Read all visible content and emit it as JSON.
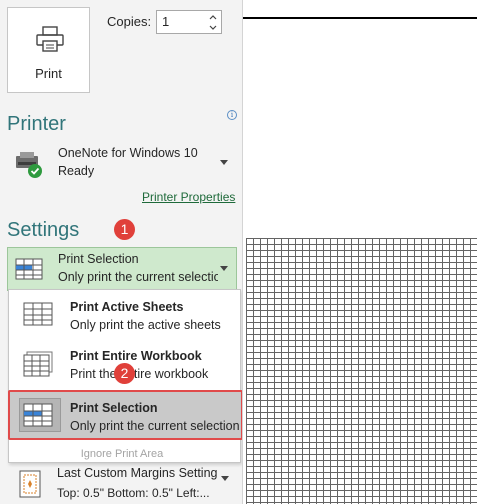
{
  "print_button": {
    "label": "Print",
    "icon": "printer-icon"
  },
  "copies": {
    "label": "Copies:",
    "value": "1"
  },
  "printer": {
    "heading": "Printer",
    "name": "OneNote for Windows 10",
    "status": "Ready",
    "properties_link": "Printer Properties",
    "info_glyph": "i"
  },
  "settings": {
    "heading": "Settings",
    "selected": {
      "title": "Print Selection",
      "subtitle": "Only print the current selection"
    },
    "menu": [
      {
        "title": "Print Active Sheets",
        "subtitle": "Only print the active sheets"
      },
      {
        "title": "Print Entire Workbook",
        "subtitle": "Print the entire workbook"
      },
      {
        "title": "Print Selection",
        "subtitle": "Only print the current selection"
      }
    ],
    "ignore_print_area": "Ignore Print Area",
    "margins": {
      "title": "Last Custom Margins Setting",
      "subtitle": "Top: 0.5\" Bottom: 0.5\" Left:..."
    }
  },
  "annotations": {
    "step1": "1",
    "step2": "2"
  },
  "colors": {
    "section_heading": "#31757a",
    "selected_bg": "#cfe9cd",
    "highlight_frame": "#e04a4a",
    "badge": "#e0403a",
    "link": "#1e6a3a"
  }
}
